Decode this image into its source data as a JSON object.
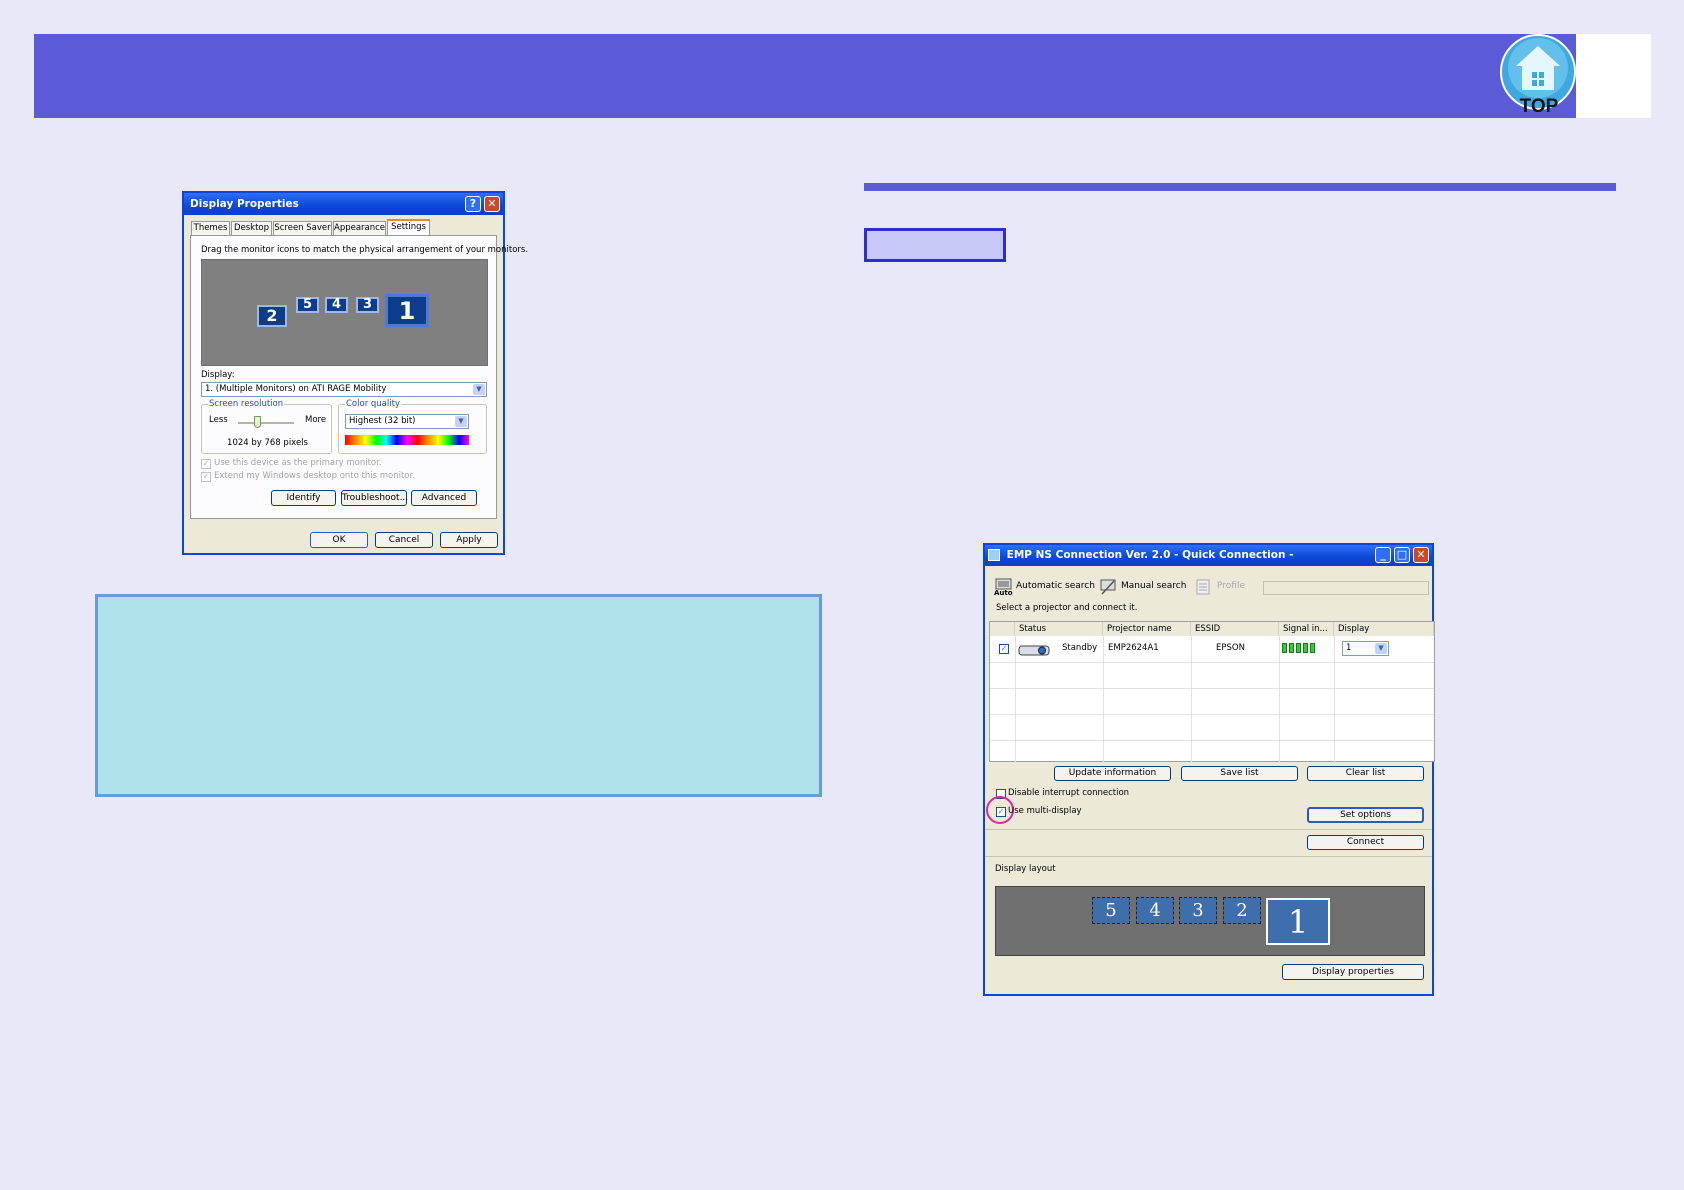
{
  "header": {
    "logo_label": "TOP"
  },
  "display_properties": {
    "title": "Display Properties",
    "tabs": [
      "Themes",
      "Desktop",
      "Screen Saver",
      "Appearance",
      "Settings"
    ],
    "active_tab": "Settings",
    "instruction": "Drag the monitor icons to match the physical arrangement of your monitors.",
    "monitors": [
      "2",
      "5",
      "4",
      "3",
      "1"
    ],
    "display_label": "Display:",
    "display_value": "1. (Multiple Monitors) on ATI RAGE Mobility",
    "resolution": {
      "label": "Screen resolution",
      "less": "Less",
      "more": "More",
      "value": "1024 by 768 pixels"
    },
    "color_quality": {
      "label": "Color quality",
      "value": "Highest (32 bit)"
    },
    "primary_checkbox": "Use this device as the primary monitor.",
    "extend_checkbox": "Extend my Windows desktop onto this monitor.",
    "buttons": {
      "identify": "Identify",
      "troubleshoot": "Troubleshoot...",
      "advanced": "Advanced",
      "ok": "OK",
      "cancel": "Cancel",
      "apply": "Apply"
    }
  },
  "emp": {
    "title": "EMP NS Connection Ver. 2.0 - Quick Connection -",
    "toolbar": {
      "auto_sub": "Auto",
      "automatic_search": "Automatic search",
      "manual_search": "Manual search",
      "profile": "Profile"
    },
    "instruction": "Select a projector and connect it.",
    "columns": [
      "Status",
      "Projector name",
      "ESSID",
      "Signal in...",
      "Display"
    ],
    "row": {
      "status": "Standby",
      "projector_name": "EMP2624A1",
      "essid": "EPSON",
      "display": "1"
    },
    "buttons": {
      "update": "Update information",
      "save_list": "Save list",
      "clear_list": "Clear list",
      "set_options": "Set options",
      "connect": "Connect",
      "display_properties": "Display properties"
    },
    "disable_interrupt": "Disable interrupt connection",
    "use_multi_display": "Use multi-display",
    "display_layout_label": "Display layout",
    "layout_monitors": [
      "5",
      "4",
      "3",
      "2",
      "1"
    ]
  }
}
